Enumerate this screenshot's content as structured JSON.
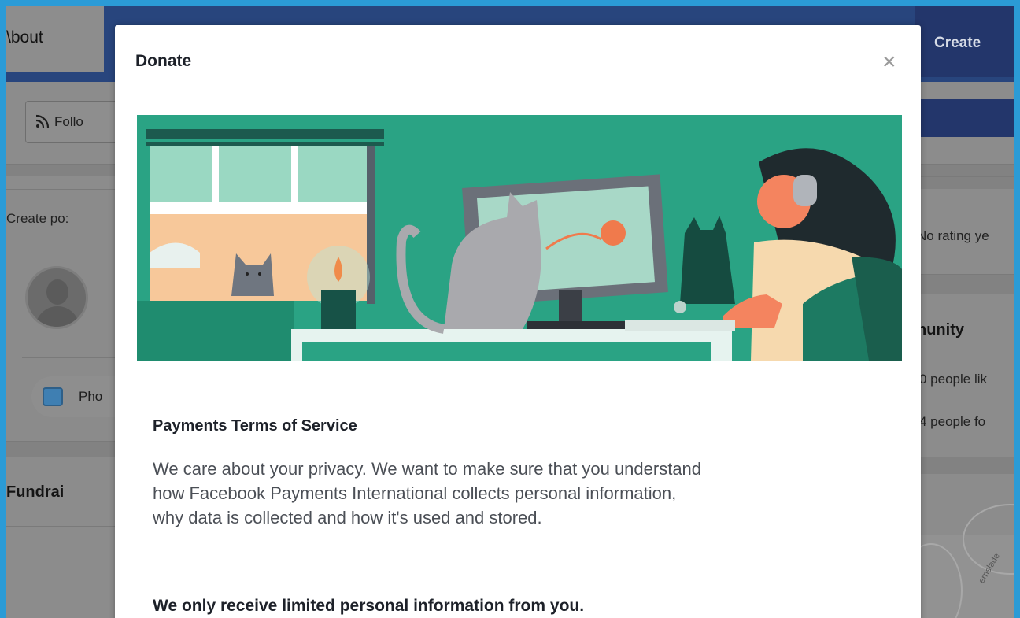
{
  "background": {
    "about_tab": "\\bout",
    "create_button": "Create",
    "follow_button": "Follo",
    "create_post": "Create po:",
    "no_rating": "No rating ye",
    "photo_button": "Pho",
    "community_title": "nunity",
    "likes_count": "0 people lik",
    "follows_count": "4 people fo",
    "fundraisers_title": "Fundrai",
    "map_street": "ernslade"
  },
  "modal": {
    "title": "Donate",
    "close_symbol": "×",
    "tos_title": "Payments Terms of Service",
    "tos_body_lines": [
      "We care about your privacy. We want to make sure that you understand",
      "how Facebook Payments International collects personal information,",
      "why data is collected and how it's used and stored."
    ],
    "limited_info_title": "We only receive limited personal information from you."
  },
  "colors": {
    "frame_border": "#2b9bd6",
    "overlay_gray": "#8c8c8c",
    "nav_blue": "#23366b",
    "banner_green": "#2aa384"
  },
  "icons": [
    "rss-icon",
    "photo-icon",
    "close-icon",
    "avatar-placeholder-icon"
  ]
}
